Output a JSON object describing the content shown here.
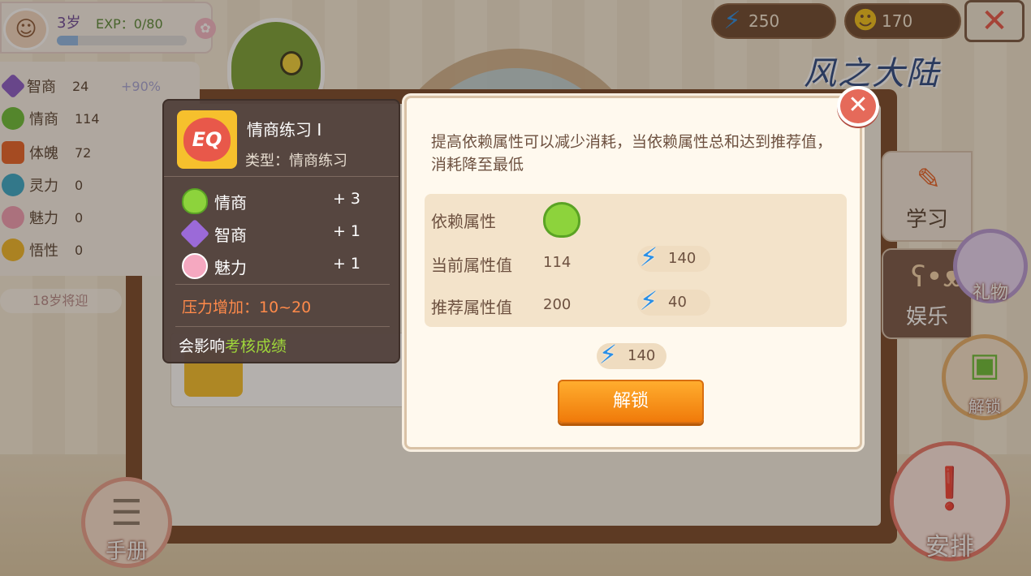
{
  "player": {
    "age": "3岁",
    "exp_label": "EXP：0/80",
    "exp_progress": 0.16
  },
  "stats": [
    {
      "name": "智商",
      "value": "24",
      "extra": "+90%",
      "color": "#8b5cc9"
    },
    {
      "name": "情商",
      "value": "114",
      "extra": "",
      "color": "#6cbf3a"
    },
    {
      "name": "体魄",
      "value": "72",
      "extra": "",
      "color": "#e8642a"
    },
    {
      "name": "灵力",
      "value": "0",
      "extra": "",
      "color": "#3aa9c9"
    },
    {
      "name": "魅力",
      "value": "0",
      "extra": "",
      "color": "#f29fb6"
    },
    {
      "name": "悟性",
      "value": "0",
      "extra": "",
      "color": "#f2b82a"
    }
  ],
  "age_note": "18岁将迎",
  "resources": {
    "energy": "250",
    "happiness": "170"
  },
  "logo": "风之大陆",
  "side_tabs": {
    "study": "学习",
    "fun": "娱乐",
    "gift": "礼物"
  },
  "corner_buttons": {
    "handbook": "手册",
    "schedule": "安排",
    "unlock": "解锁"
  },
  "skill": {
    "icon_text": "EQ",
    "title": "情商练习 I",
    "type": "类型：情商练习",
    "effects": [
      {
        "name": "情商",
        "value": "+ 3",
        "icon": "green-heart-icon"
      },
      {
        "name": "智商",
        "value": "+ 1",
        "icon": "purple-gem-icon"
      },
      {
        "name": "魅力",
        "value": "+ 1",
        "icon": "pink-flower-icon"
      }
    ],
    "pressure": "压力增加：10~20",
    "affects_prefix": "会影响",
    "affects_highlight": "考核成绩"
  },
  "dialog": {
    "description": "提高依赖属性可以减少消耗，当依赖属性总和达到推荐值，消耗降至最低",
    "dependency_label": "依赖属性",
    "current_label": "当前属性值",
    "current_value": "114",
    "current_cost": "140",
    "recommended_label": "推荐属性值",
    "recommended_value": "200",
    "recommended_cost": "40",
    "total_cost": "140",
    "unlock_button": "解锁"
  },
  "colors": {
    "accent": "#f08a14",
    "panel": "#52423c",
    "energy": "#2a8fe6"
  }
}
